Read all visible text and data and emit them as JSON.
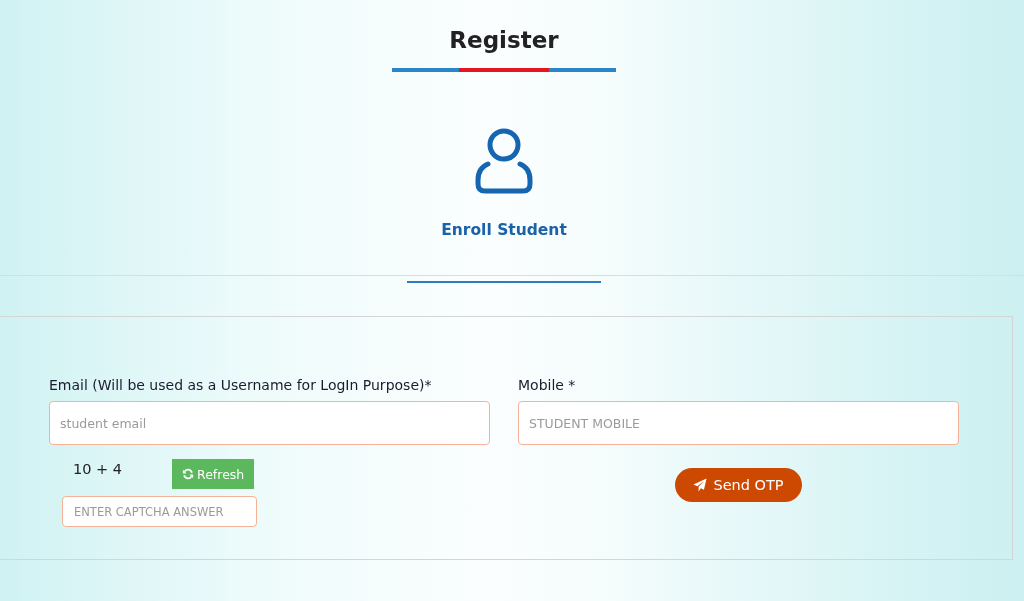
{
  "header": {
    "title": "Register"
  },
  "role": {
    "label": "Enroll Student"
  },
  "form": {
    "email": {
      "label": "Email (Will be used as a Username for LogIn Purpose)*",
      "placeholder": "student email"
    },
    "mobile": {
      "label": "Mobile *",
      "placeholder": "STUDENT MOBILE"
    },
    "captcha": {
      "question": "10 + 4",
      "refresh_button": "Refresh",
      "placeholder": "ENTER CAPTCHA ANSWER"
    },
    "send_otp_button": "Send OTP"
  }
}
